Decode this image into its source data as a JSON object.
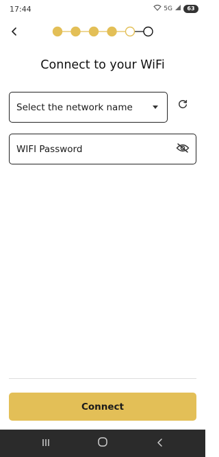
{
  "status_bar": {
    "time": "17:44",
    "network_label": "5G",
    "battery_level": "63"
  },
  "stepper": {
    "total_steps": 6,
    "completed_steps": 4,
    "current_step": 5,
    "colors": {
      "active": "#e3bf57",
      "inactive": "#111111"
    }
  },
  "header": {
    "back_icon": "chevron-left-icon",
    "title": "Connect to your WiFi"
  },
  "network_select": {
    "label": "Select the network name",
    "icon": "caret-down-icon"
  },
  "refresh": {
    "icon": "refresh-icon"
  },
  "password": {
    "placeholder": "WIFI Password",
    "value": "",
    "toggle_icon": "eye-off-icon"
  },
  "footer": {
    "connect_label": "Connect",
    "button_color": "#e3bf57"
  },
  "nav_bar": {
    "recents_icon": "recents-icon",
    "home_icon": "home-icon",
    "back_icon": "back-nav-icon"
  }
}
